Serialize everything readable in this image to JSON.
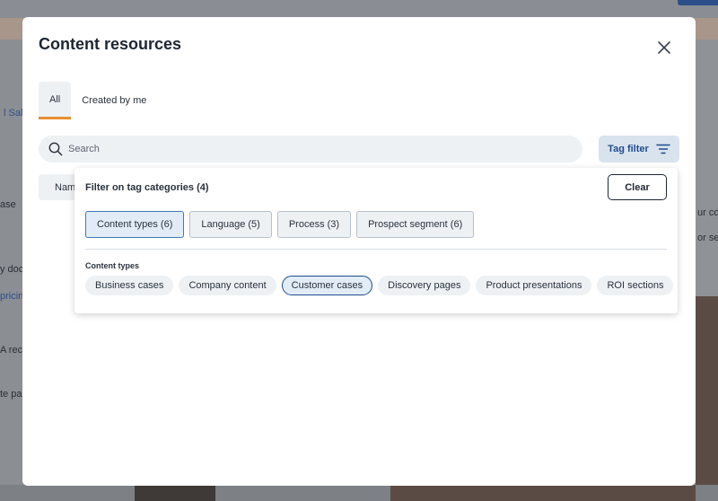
{
  "background": {
    "left_fragments": [
      "l Sale",
      "ase",
      "y doc",
      "pricin",
      "A reco",
      "te pag"
    ],
    "right_fragments": [
      "ur co",
      "or se"
    ]
  },
  "modal": {
    "title": "Content resources",
    "close_icon": "close-icon"
  },
  "tabs": [
    {
      "label": "All",
      "active": true
    },
    {
      "label": "Created by me",
      "active": false
    }
  ],
  "search": {
    "placeholder": "Search",
    "value": "",
    "icon": "search-icon"
  },
  "tag_filter": {
    "label": "Tag filter",
    "icon": "filter-icon"
  },
  "name_column": {
    "label": "Nam"
  },
  "filter_panel": {
    "title": "Filter on tag categories (4)",
    "clear_label": "Clear",
    "categories": [
      {
        "label": "Content types (6)",
        "active": true
      },
      {
        "label": "Language (5)",
        "active": false
      },
      {
        "label": "Process (3)",
        "active": false
      },
      {
        "label": "Prospect segment (6)",
        "active": false
      }
    ],
    "section_label": "Content types",
    "tags": [
      {
        "label": "Business cases",
        "selected": false
      },
      {
        "label": "Company content",
        "selected": false
      },
      {
        "label": "Customer cases",
        "selected": true
      },
      {
        "label": "Discovery pages",
        "selected": false
      },
      {
        "label": "Product presentations",
        "selected": false
      },
      {
        "label": "ROI sections",
        "selected": false
      }
    ]
  },
  "colors": {
    "accent_orange": "#e8902e",
    "accent_blue": "#1e4d8c",
    "chip_bg": "#eef1f4"
  }
}
